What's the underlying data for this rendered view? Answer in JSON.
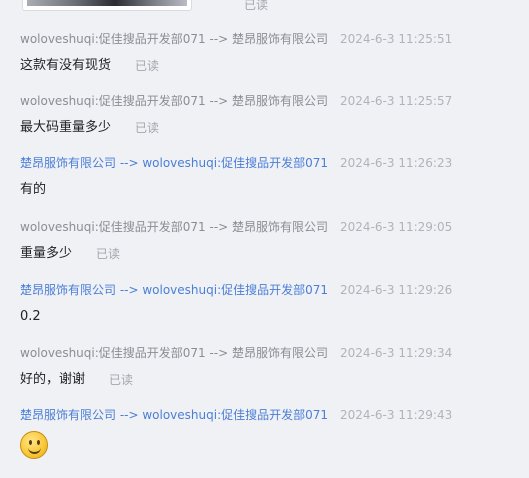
{
  "top": {
    "read_label": "已读"
  },
  "messages": [
    {
      "sender": "woloveshuqi:促佳搜品开发部071 --> 楚昂服饰有限公司",
      "time": "2024-6-3 11:25:51",
      "text": "这款有没有现货",
      "read": "已读"
    },
    {
      "sender": "woloveshuqi:促佳搜品开发部071 --> 楚昂服饰有限公司",
      "time": "2024-6-3 11:25:57",
      "text": "最大码重量多少",
      "read": "已读"
    },
    {
      "sender": "楚昂服饰有限公司 --> woloveshuqi:促佳搜品开发部071",
      "time": "2024-6-3 11:26:23",
      "text": "有的"
    },
    {
      "sender": "woloveshuqi:促佳搜品开发部071 --> 楚昂服饰有限公司",
      "time": "2024-6-3 11:29:05",
      "text": "重量多少",
      "read": "已读"
    },
    {
      "sender": "楚昂服饰有限公司 --> woloveshuqi:促佳搜品开发部071",
      "time": "2024-6-3 11:29:26",
      "text": "0.2"
    },
    {
      "sender": "woloveshuqi:促佳搜品开发部071 --> 楚昂服饰有限公司",
      "time": "2024-6-3 11:29:34",
      "text": "好的，谢谢",
      "read": "已读"
    },
    {
      "sender": "楚昂服饰有限公司 --> woloveshuqi:促佳搜品开发部071",
      "time": "2024-6-3 11:29:43",
      "emoji": "smile-emoji"
    }
  ]
}
